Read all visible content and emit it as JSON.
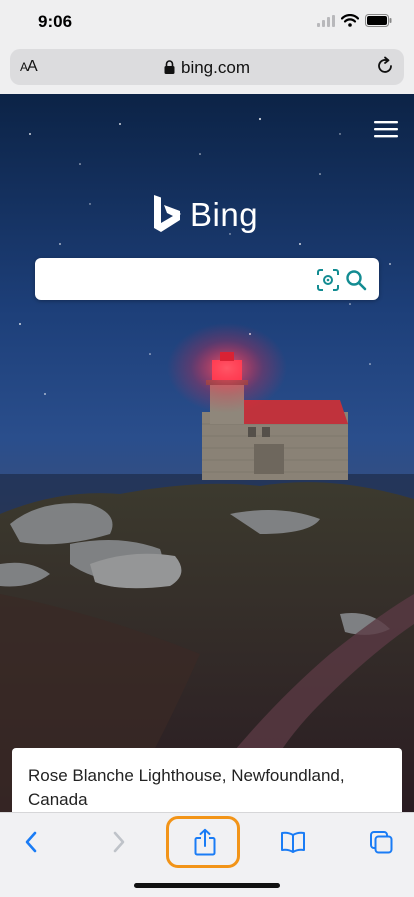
{
  "status_bar": {
    "time": "9:06"
  },
  "address_bar": {
    "aa_small": "A",
    "aa_large": "A",
    "url": "bing.com"
  },
  "hero": {
    "brand": "Bing",
    "search": {
      "placeholder": ""
    },
    "caption": "Rose Blanche Lighthouse, Newfoundland, Canada"
  },
  "toolbar": {
    "back_icon": "chevron-left-icon",
    "forward_icon": "chevron-right-icon",
    "share_icon": "share-icon",
    "bookmarks_icon": "book-icon",
    "tabs_icon": "tabs-icon"
  },
  "colors": {
    "accent": "#1a7cf5",
    "highlight": "#f29418",
    "teal": "#138c92"
  }
}
